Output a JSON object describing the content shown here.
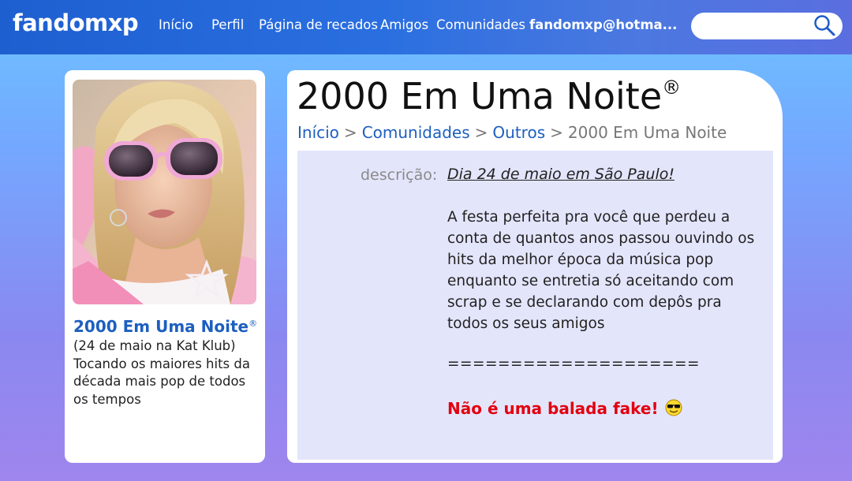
{
  "header": {
    "logo": "fandomxp",
    "nav": [
      "Início",
      "Perfil",
      "Página de recados",
      "Amigos",
      "Comunidades"
    ],
    "user_email": "fandomxp@hotma...",
    "search_placeholder": ""
  },
  "community": {
    "name": "2000 Em Uma Noite",
    "reg_mark": "®",
    "sidebar_subtitle": "(24 de maio na Kat Klub)",
    "sidebar_text": "Tocando os maiores hits da década mais pop de todos os tempos"
  },
  "breadcrumb": {
    "items": [
      "Início",
      "Comunidades",
      "Outros"
    ],
    "separator": ">",
    "current": "2000 Em Uma Noite"
  },
  "description": {
    "label": "descrição:",
    "headline": "Dia 24 de maio em São Paulo!",
    "body": "A festa perfeita pra você que perdeu a conta de quantos anos passou ouvindo os hits da melhor época da música pop enquanto se entretia só aceitando com scrap e se declarando com depôs pra todos os seus amigos",
    "separator_line": "====================",
    "highlight": "Não é uma balada fake!",
    "highlight_icon": "sunglasses-smiley-icon"
  },
  "colors": {
    "link": "#1d5fbf",
    "highlight": "#e3000f",
    "desc_bg": "#e3e5fb"
  }
}
